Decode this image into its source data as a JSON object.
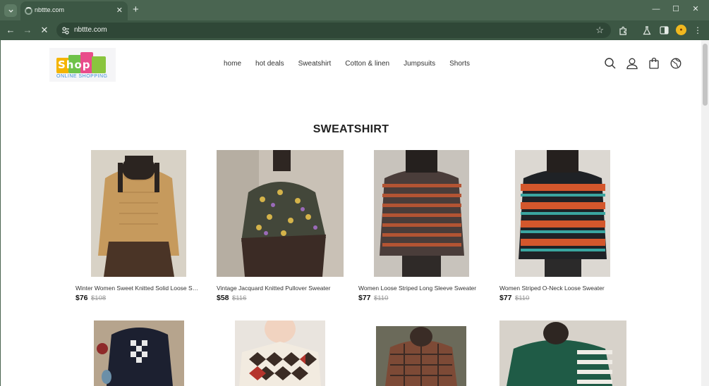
{
  "browser": {
    "tab_title": "nbttte.com",
    "url": "nbttte.com",
    "window_buttons": {
      "minimize": "—",
      "maximize": "☐",
      "close": "✕"
    }
  },
  "site": {
    "logo_text": "Shop",
    "logo_sub": "ONLINE SHOPPING",
    "nav": [
      "home",
      "hot deals",
      "Sweatshirt",
      "Cotton & linen",
      "Jumpsuits",
      "Shorts"
    ]
  },
  "section_title": "SWEATSHIRT",
  "products": [
    {
      "name": "Winter Women Sweet Knitted Solid Loose Sw...",
      "price": "$76",
      "old_price": "$108"
    },
    {
      "name": "Vintage Jacquard Knitted Pullover Sweater",
      "price": "$58",
      "old_price": "$116"
    },
    {
      "name": "Women Loose Striped Long Sleeve Sweater",
      "price": "$77",
      "old_price": "$110"
    },
    {
      "name": "Women Striped O-Neck Loose Sweater",
      "price": "$77",
      "old_price": "$110"
    }
  ],
  "colors": {
    "chrome": "#4a6551",
    "toolbar": "#3c5744",
    "omnibox": "#2f4737"
  }
}
